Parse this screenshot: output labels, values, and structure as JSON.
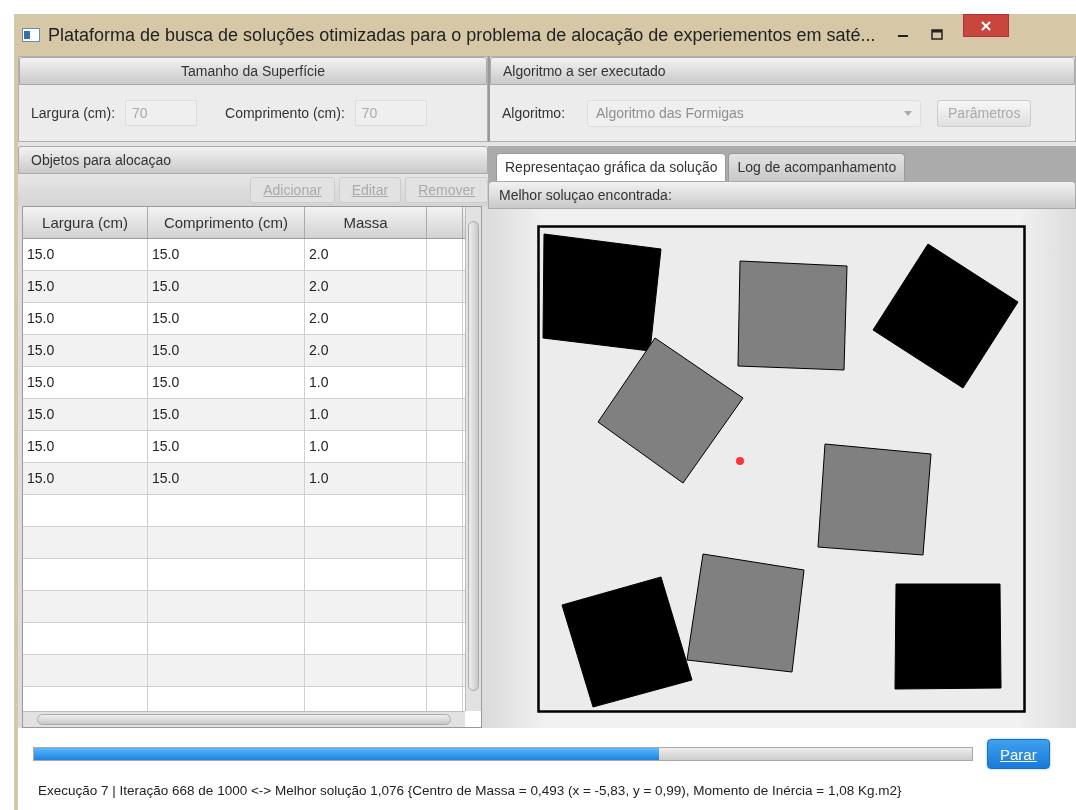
{
  "window": {
    "title": "Plataforma de busca de soluções otimizadas para o problema de alocação de experiementos em saté..."
  },
  "surface": {
    "header": "Tamanho da Superfície",
    "fields": [
      {
        "label": "Largura (cm):",
        "value": "70",
        "disabled": true
      },
      {
        "label": "Comprimento (cm):",
        "value": "70",
        "disabled": true
      }
    ]
  },
  "algorithm": {
    "header": "Algoritmo a ser executado",
    "label": "Algoritmo:",
    "select": {
      "value": "Algoritmo das Formigas",
      "disabled": true
    },
    "button": {
      "label": "Parâmetros",
      "disabled": true
    }
  },
  "objects": {
    "header": "Objetos para alocaçao",
    "buttons": [
      {
        "label": "Adicionar",
        "disabled": true
      },
      {
        "label": "Editar",
        "disabled": true
      },
      {
        "label": "Remover",
        "disabled": true
      }
    ],
    "table": {
      "columns": [
        "Largura (cm)",
        "Comprimento (cm)",
        "Massa"
      ],
      "rows": [
        [
          "15.0",
          "15.0",
          "2.0"
        ],
        [
          "15.0",
          "15.0",
          "2.0"
        ],
        [
          "15.0",
          "15.0",
          "2.0"
        ],
        [
          "15.0",
          "15.0",
          "2.0"
        ],
        [
          "15.0",
          "15.0",
          "1.0"
        ],
        [
          "15.0",
          "15.0",
          "1.0"
        ],
        [
          "15.0",
          "15.0",
          "1.0"
        ],
        [
          "15.0",
          "15.0",
          "1.0"
        ]
      ]
    }
  },
  "tabs": [
    {
      "label": "Representaçao gráfica da solução",
      "selected": true
    },
    {
      "label": "Log de acompanhamento",
      "selected": false
    }
  ],
  "solution": {
    "header": "Melhor soluçao encontrada:"
  },
  "progress": {
    "level": 0.666
  },
  "stop_button": "Parar",
  "status_bar": "Execução 7 | Iteração 668 de 1000 <-> Melhor solução 1,076 {Centro de Massa = 0,493 (x = -5,83, y = 0,99), Momento de Inércia = 1,08 Kg.m2}"
}
